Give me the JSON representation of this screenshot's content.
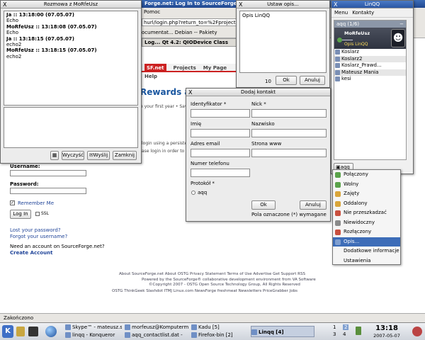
{
  "browser": {
    "title": "Forge.net: Log In to SourceForge.net",
    "menu": "Pomoc",
    "url": "hurl/login.php?return_to=%2Fproject%2",
    "bookmarks": "ocumentat...    Debian -- Pakiety",
    "tab_label": "Log...    Qt 4.2: QIODevice Class",
    "nav": [
      "SF.net",
      "Projects",
      "My Page",
      "Help"
    ],
    "rewards": "Rewards add",
    "rewards_sub": "e your first year  •  Save",
    "login_text1": "login using a persistent",
    "login_text2": "ase login in order to gain",
    "username_label": "Username:",
    "password_label": "Password:",
    "remember_label": "Remember Me",
    "login_button": "Log In",
    "ssl_label": "SSL",
    "lost_password": "Lost your password?",
    "forgot_username": "Forgot your username?",
    "need_account": "Need an account on SourceForge.net?",
    "create_account": "Create Account",
    "footer_links1": "About SourceForge.net    About OSTG    Privacy Statement    Terms of Use    Advertise    Get Support    RSS",
    "footer_line2": "Powered by the SourceForge® collaborative development environment from VA Software",
    "footer_line3": "©Copyright 2007 - OSTG Open Source Technology Group, All Rights Reserved",
    "footer_links2": "OSTG    ThinkGeek    Slashdot    ITMJ    Linux.com    NewsForge    freshmeat    Newsletters    PriceGrabber    Jobs",
    "status": "Zakończono"
  },
  "chat": {
    "title": "Rozmowa z MoRfeUsz",
    "messages": [
      {
        "head": "Ja :: 13:18:00 (07.05.07)",
        "body": "Echo"
      },
      {
        "head": "MoRfeUsz :: 13:18:08 (07.05.07)",
        "body": "Echo"
      },
      {
        "head": "Ja :: 13:18:15 (07.05.07)",
        "body": "echo2"
      },
      {
        "head": "MoRfeUsz :: 13:18:15 (07.05.07)",
        "body": "echo2"
      }
    ],
    "clear_label": "Wyczyść",
    "send_label": "Wyślij",
    "close_label": "Zamknij"
  },
  "desc": {
    "title": "Ustaw opis...",
    "value": "Opis LinQQ",
    "count": "10",
    "ok_label": "Ok",
    "cancel_label": "Anuluj"
  },
  "add_contact": {
    "title": "Dodaj kontakt",
    "id_label": "Identyfikator *",
    "nick_label": "Nick *",
    "first_label": "Imię",
    "last_label": "Nazwisko",
    "email_label": "Adres email",
    "www_label": "Strona www",
    "phone_label": "Numer telefonu",
    "protocol_label": "Protokół *",
    "protocol_option": "aqq",
    "ok_label": "Ok",
    "cancel_label": "Anuluj",
    "note": "Pola oznaczone (*) wymagane"
  },
  "linqq": {
    "title": "LinQQ",
    "menu": [
      "Menu",
      "Kontakty"
    ],
    "group": "aqq (1/6)",
    "own_name": "MoRfeUsz",
    "own_status": "Opis LinQQ",
    "contacts": [
      "Koslarz",
      "Koslarz2",
      "Koslarz_Prawd...",
      "Mateusz Mania",
      "kesi"
    ],
    "status_button": "aqq"
  },
  "status_menu": {
    "items": [
      {
        "label": "Połączony",
        "color": "#5aa24a"
      },
      {
        "label": "Wolny",
        "color": "#5aa24a"
      },
      {
        "label": "Zajęty",
        "color": "#d9a53a"
      },
      {
        "label": "Oddalony",
        "color": "#d9a53a"
      },
      {
        "label": "Nie przeszkadzać",
        "color": "#c9503f"
      },
      {
        "label": "Niewidoczny",
        "color": "#8a8a8a"
      },
      {
        "label": "Rozłączony",
        "color": "#c9503f"
      },
      {
        "label": "Opis...",
        "color": "#7f9fd0"
      },
      {
        "label": "Dodatkowe informacje",
        "color": ""
      },
      {
        "label": "Ustawienia",
        "color": ""
      }
    ],
    "selected_index": 7
  },
  "taskbar": {
    "tasks": [
      "Skype™ - mateusz.sz",
      "linqq - Konqueror",
      "morfeusz@Komputerm",
      "aqq_contactlist.dat -",
      "Kadu [5]",
      "Firefox-bin [2]",
      "Linqq [4]"
    ],
    "desktops": [
      "1",
      "2",
      "3",
      "4"
    ],
    "time": "13:18",
    "date": "2007-05-07"
  }
}
